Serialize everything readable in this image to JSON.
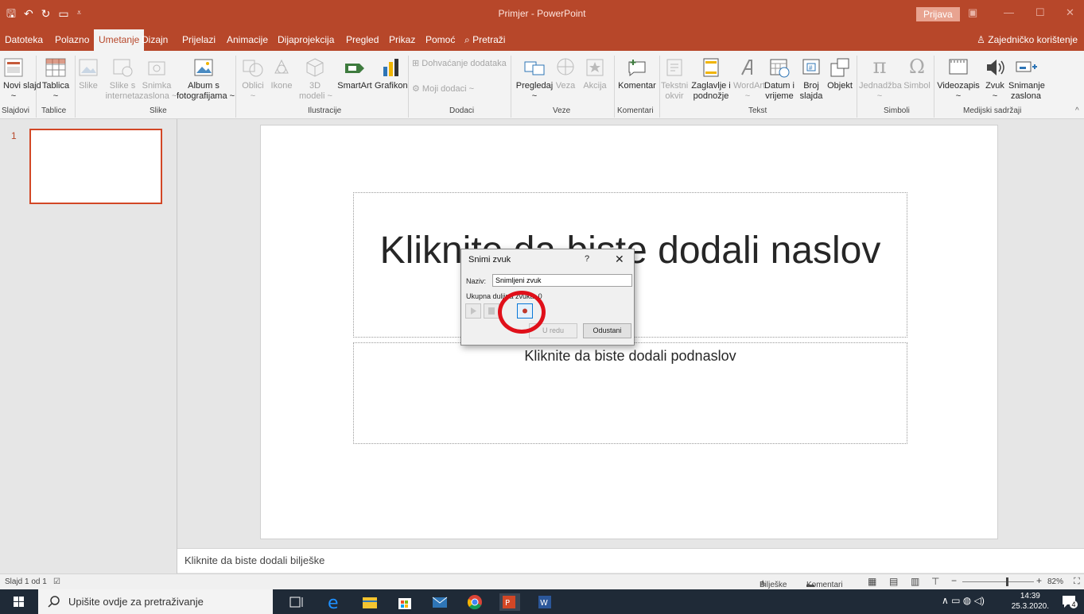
{
  "window": {
    "title": "Primjer  -  PowerPoint",
    "signin_label": "Prijava",
    "quick_access": [
      "save-icon",
      "undo-icon",
      "redo-icon",
      "start-from-beginning-icon",
      "customize-icon"
    ],
    "controls": [
      "ribbon-options-icon",
      "minimize-icon",
      "maximize-icon",
      "close-icon"
    ]
  },
  "tabs": [
    {
      "label": "Datoteka"
    },
    {
      "label": "Polazno"
    },
    {
      "label": "Umetanje",
      "active": true
    },
    {
      "label": "Dizajn"
    },
    {
      "label": "Prijelazi"
    },
    {
      "label": "Animacije"
    },
    {
      "label": "Dijaprojekcija"
    },
    {
      "label": "Pregled"
    },
    {
      "label": "Prikaz"
    },
    {
      "label": "Pomoć"
    },
    {
      "label": "Pretraži"
    }
  ],
  "share_label": "Zajedničko korištenje",
  "ribbon": {
    "buttons": [
      {
        "label": "Novi slajd",
        "sub": "~",
        "icon": "new-slide-icon"
      },
      {
        "label": "Tablica",
        "sub": "~",
        "icon": "table-icon"
      },
      {
        "label": "Slike",
        "sub": "",
        "icon": "pictures-icon",
        "disabled": true
      },
      {
        "label": "Slike s",
        "sub": "interneta",
        "icon": "online-pictures-icon",
        "disabled": true
      },
      {
        "label": "Snimka",
        "sub": "zaslona ~",
        "icon": "screenshot-icon",
        "disabled": true
      },
      {
        "label": "Album s",
        "sub": "fotografijama ~",
        "icon": "photo-album-icon"
      },
      {
        "label": "Oblici",
        "sub": "~",
        "icon": "shapes-icon",
        "disabled": true
      },
      {
        "label": "Ikone",
        "sub": "",
        "icon": "icons-icon",
        "disabled": true
      },
      {
        "label": "3D",
        "sub": "modeli ~",
        "icon": "3d-models-icon",
        "disabled": true
      },
      {
        "label": "SmartArt",
        "sub": "",
        "icon": "smartart-icon"
      },
      {
        "label": "Grafikon",
        "sub": "",
        "icon": "chart-icon"
      },
      {
        "label": "Pregledaj",
        "sub": "~",
        "icon": "zoom-icon"
      },
      {
        "label": "Veza",
        "sub": "",
        "icon": "link-icon",
        "disabled": true
      },
      {
        "label": "Akcija",
        "sub": "",
        "icon": "action-icon",
        "disabled": true
      },
      {
        "label": "Komentar",
        "sub": "",
        "icon": "comment-icon"
      },
      {
        "label": "Tekstni",
        "sub": "okvir",
        "icon": "text-box-icon",
        "disabled": true
      },
      {
        "label": "Zaglavlje i",
        "sub": "podnožje",
        "icon": "header-footer-icon"
      },
      {
        "label": "WordArt",
        "sub": "~",
        "icon": "wordart-icon",
        "disabled": true
      },
      {
        "label": "Datum i",
        "sub": "vrijeme",
        "icon": "date-time-icon"
      },
      {
        "label": "Broj",
        "sub": "slajda",
        "icon": "slide-number-icon"
      },
      {
        "label": "Objekt",
        "sub": "",
        "icon": "object-icon"
      },
      {
        "label": "Jednadžba",
        "sub": "~",
        "icon": "equation-icon",
        "disabled": true
      },
      {
        "label": "Simbol",
        "sub": "",
        "icon": "symbol-icon",
        "disabled": true
      },
      {
        "label": "Videozapis",
        "sub": "~",
        "icon": "video-icon"
      },
      {
        "label": "Zvuk",
        "sub": "~",
        "icon": "audio-icon"
      },
      {
        "label": "Snimanje",
        "sub": "zaslona",
        "icon": "screen-recording-icon"
      }
    ],
    "addins": {
      "get": "Dohvaćanje dodataka",
      "my": "Moji dodaci ~"
    },
    "groups": [
      "Slajdovi",
      "Tablice",
      "Slike",
      "Ilustracije",
      "Dodaci",
      "Veze",
      "Komentari",
      "Tekst",
      "Simboli",
      "Medijski sadržaji"
    ]
  },
  "slides_pane": {
    "slide_number": "1"
  },
  "slide": {
    "title_placeholder": "Kliknite da biste dodali naslov",
    "subtitle_placeholder": "Kliknite da biste dodali podnaslov"
  },
  "notes_placeholder": "Kliknite da biste dodali bilješke",
  "dialog": {
    "title": "Snimi zvuk",
    "help": "?",
    "close": "✕",
    "name_label": "Naziv:",
    "name_value": "Snimljeni zvuk",
    "length_label": "Ukupna duljina zvuka:",
    "length_value": "0",
    "ok_label": "U redu",
    "cancel_label": "Odustani",
    "record_color": "#c0392b"
  },
  "statusbar": {
    "slide_info": "Slajd 1 od 1",
    "notes_label": "Bilješke",
    "comments_label": "Komentari",
    "zoom_value": "82%"
  },
  "taskbar": {
    "search_placeholder": "Upišite ovdje za pretraživanje",
    "time": "14:39",
    "date": "25.3.2020.",
    "notifications": "4"
  },
  "colors": {
    "accent": "#b7472a",
    "highlight_ring": "#e0101a"
  }
}
